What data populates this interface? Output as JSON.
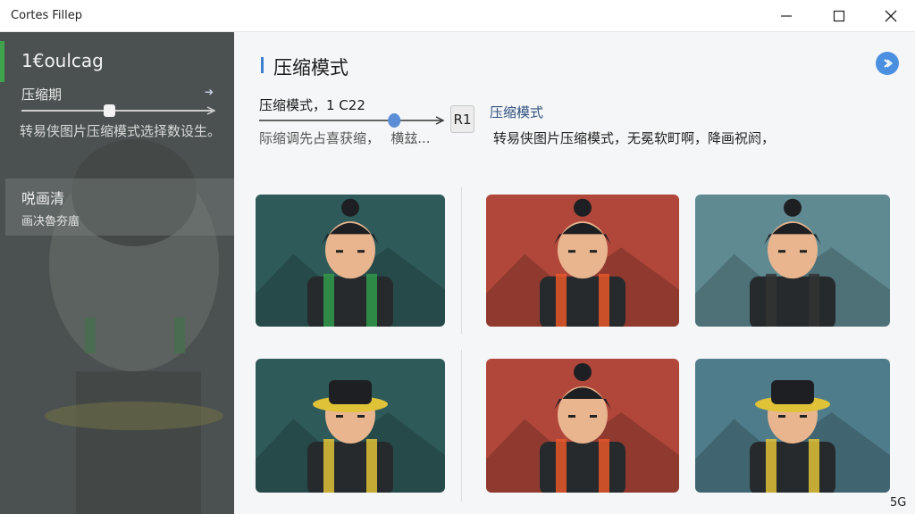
{
  "window": {
    "title": "Cortes Fillep",
    "controls": {
      "minimize_icon": "minimize-icon",
      "maximize_icon": "maximize-icon",
      "close_icon": "close-icon"
    }
  },
  "sidebar": {
    "title": "1€oulcag",
    "slider_label": "压缩期",
    "slider_value": 0.46,
    "description": "转易侠图片压缩模式选择数设生。",
    "panel": {
      "title": "哾画清",
      "subtitle": "画决魯夯庿"
    }
  },
  "main": {
    "title": "压缩模式",
    "help_icon": "help-icon",
    "control": {
      "label": "压缩模式，1 C22",
      "slider_value": 0.72,
      "button_label": "R1",
      "hint": "际缩调先占喜获缩，　 横玆..."
    },
    "mode": {
      "link": "压缩模式",
      "description": "转易侠图片压缩模式，无冕软町啊，降画祝阏，"
    },
    "thumbnails": [
      {
        "name": "character-forest-teal",
        "bg": "#2f5a5a",
        "accent": "#2f9a4a"
      },
      {
        "name": "character-red-headband",
        "bg": "#b0473a",
        "accent": "#e8572a"
      },
      {
        "name": "character-mountain-teal",
        "bg": "#5f8a92",
        "accent": "#333333"
      },
      {
        "name": "character-hat-teal",
        "bg": "#2f5a5a",
        "accent": "#e0c238"
      },
      {
        "name": "character-red-scowl",
        "bg": "#b0473a",
        "accent": "#e8572a"
      },
      {
        "name": "character-masked-hat",
        "bg": "#4f7c8a",
        "accent": "#e0c238"
      }
    ]
  },
  "footer": {
    "corner_text": "5G"
  },
  "colors": {
    "sidebar_bg": "#4c5150",
    "accent_green": "#3ea34a",
    "accent_blue": "#3d7fd0",
    "main_bg": "#f5f6f7"
  }
}
